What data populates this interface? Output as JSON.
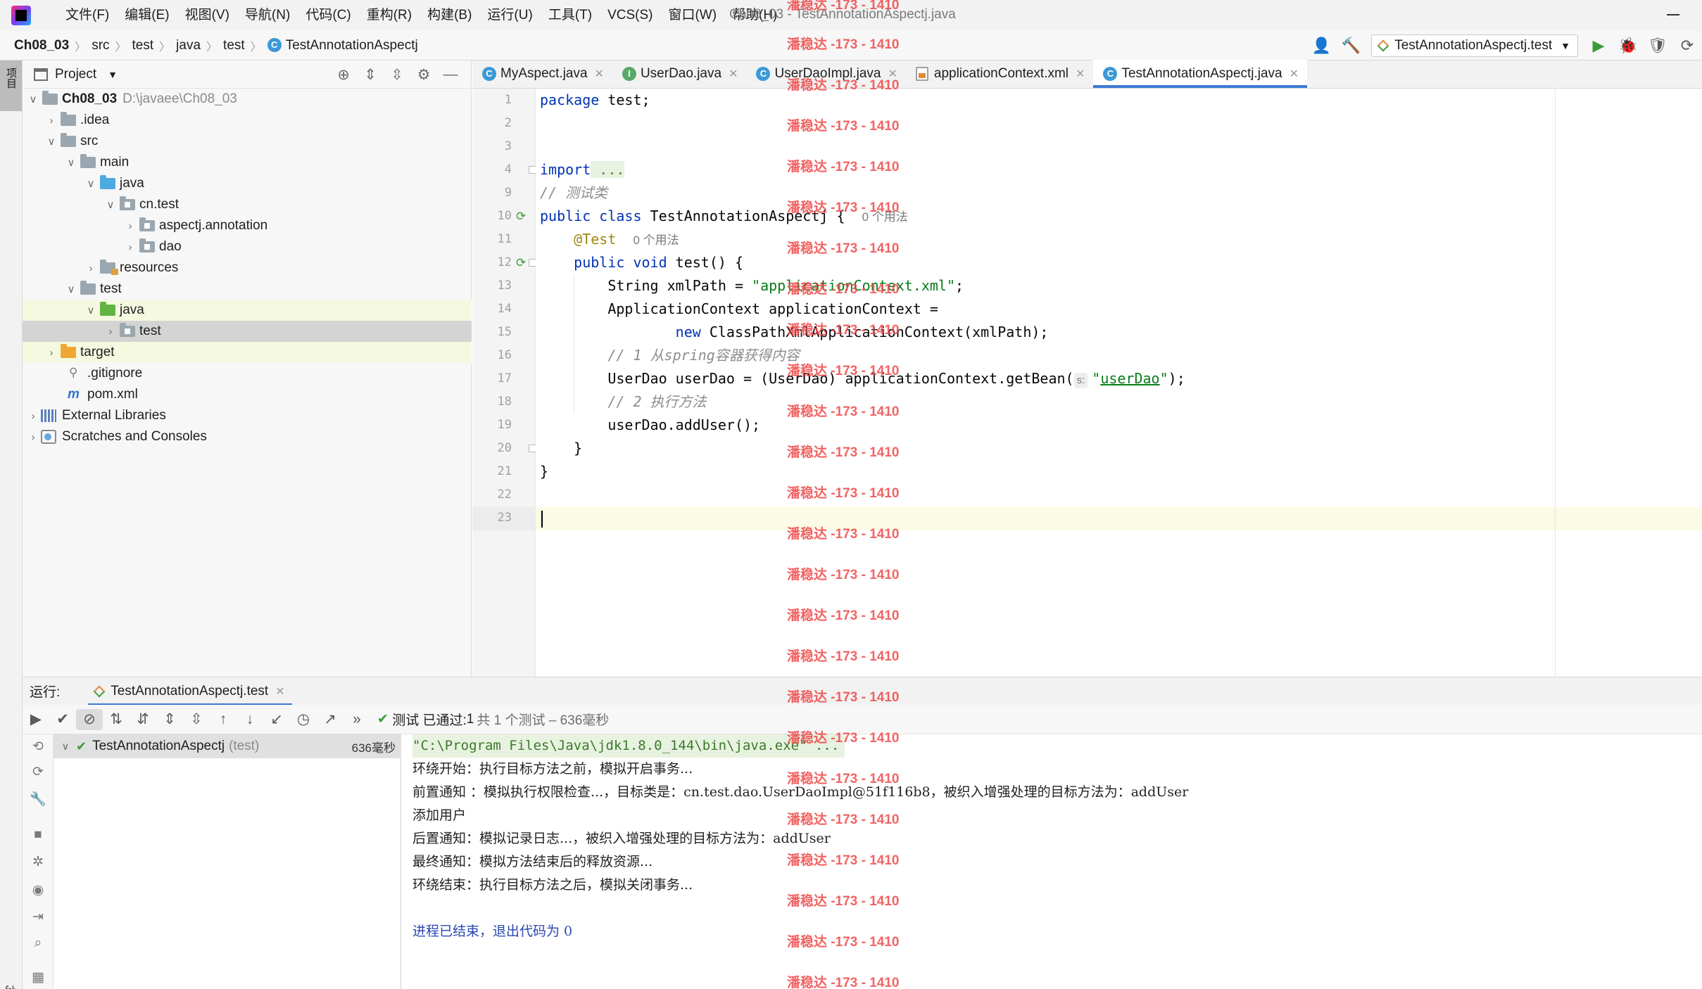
{
  "menubar": {
    "items": [
      "文件(F)",
      "编辑(E)",
      "视图(V)",
      "导航(N)",
      "代码(C)",
      "重构(R)",
      "构建(B)",
      "运行(U)",
      "工具(T)",
      "VCS(S)",
      "窗口(W)",
      "帮助(H)"
    ],
    "window_title": "Ch08_03 - TestAnnotationAspectj.java"
  },
  "navbar": {
    "breadcrumbs": [
      "Ch08_03",
      "src",
      "test",
      "java",
      "test",
      "TestAnnotationAspectj"
    ],
    "run_config": "TestAnnotationAspectj.test"
  },
  "sidebar": {
    "project_tab": "项目",
    "structure_tab": "结构"
  },
  "project_panel": {
    "title": "Project",
    "root_name": "Ch08_03",
    "root_path": "D:\\javaee\\Ch08_03",
    "items": [
      {
        "label": ".idea"
      },
      {
        "label": "src"
      },
      {
        "label": "main"
      },
      {
        "label": "java"
      },
      {
        "label": "cn.test"
      },
      {
        "label": "aspectj.annotation"
      },
      {
        "label": "dao"
      },
      {
        "label": "resources"
      },
      {
        "label": "test"
      },
      {
        "label": "java"
      },
      {
        "label": "test"
      },
      {
        "label": "target"
      },
      {
        "label": ".gitignore"
      },
      {
        "label": "pom.xml"
      },
      {
        "label": "External Libraries"
      },
      {
        "label": "Scratches and Consoles"
      }
    ]
  },
  "editor": {
    "tabs": [
      {
        "label": "MyAspect.java",
        "icon": "class-icon"
      },
      {
        "label": "UserDao.java",
        "icon": "interface-icon"
      },
      {
        "label": "UserDaoImpl.java",
        "icon": "class-icon"
      },
      {
        "label": "applicationContext.xml",
        "icon": "xml-icon"
      },
      {
        "label": "TestAnnotationAspectj.java",
        "icon": "class-icon",
        "active": true
      }
    ],
    "line_numbers": [
      "1",
      "2",
      "3",
      "4",
      "9",
      "10",
      "11",
      "12",
      "13",
      "14",
      "15",
      "16",
      "17",
      "18",
      "19",
      "20",
      "21",
      "22",
      "23"
    ],
    "code": {
      "l1_kw": "package",
      "l1_rest": " test;",
      "l4_kw": "import",
      "l4_fold": " ...",
      "l9_comment": "// 测试类",
      "l10_kw": "public class",
      "l10_rest": " TestAnnotationAspectj {",
      "l10_hint": "0 个用法",
      "l11_ann": "@Test",
      "l11_hint": "0 个用法",
      "l12_kw": "public void",
      "l12_rest": " test() {",
      "l13_a": "String xmlPath = ",
      "l13_str": "\"applicationContext.xml\"",
      "l13_b": ";",
      "l14": "ApplicationContext applicationContext =",
      "l15_kw": "new",
      "l15_rest": " ClassPathXmlApplicationContext(xmlPath);",
      "l16_comment": "// 1 从spring容器获得内容",
      "l17_a": "UserDao userDao = (UserDao) applicationContext.getBean(",
      "l17_hint": "s:",
      "l17_q1": "\"",
      "l17_str": "userDao",
      "l17_q2": "\"",
      "l17_b": ");",
      "l18_comment": "// 2 执行方法",
      "l19": "userDao.addUser();",
      "l20": "}",
      "l21": "}"
    }
  },
  "run_panel": {
    "label": "运行:",
    "tab": "TestAnnotationAspectj.test",
    "status_check": "测试 已通过:",
    "status_count": "1",
    "status_meta": "共 1 个测试 – 636毫秒",
    "test_name": "TestAnnotationAspectj",
    "test_sub": "(test)",
    "test_time": "636毫秒",
    "console": [
      "\"C:\\Program Files\\Java\\jdk1.8.0_144\\bin\\java.exe\" ...",
      "环绕开始：执行目标方法之前，模拟开启事务...",
      "前置通知 ：模拟执行权限检查...，目标类是：cn.test.dao.UserDaoImpl@51f116b8，被织入增强处理的目标方法为：addUser",
      "添加用户",
      "后置通知：模拟记录日志...，被织入增强处理的目标方法为：addUser",
      "最终通知：模拟方法结束后的释放资源...",
      "环绕结束：执行目标方法之后，模拟关闭事务...",
      "",
      "进程已结束，退出代码为 0"
    ]
  },
  "watermark": "潘稳达 -173 - 1410",
  "colors": {
    "keyword": "#0033b3",
    "string": "#067d17",
    "annotation": "#9e880d",
    "comment": "#8c8c8c",
    "accent": "#3d7ad6",
    "watermark": "#f04848"
  }
}
